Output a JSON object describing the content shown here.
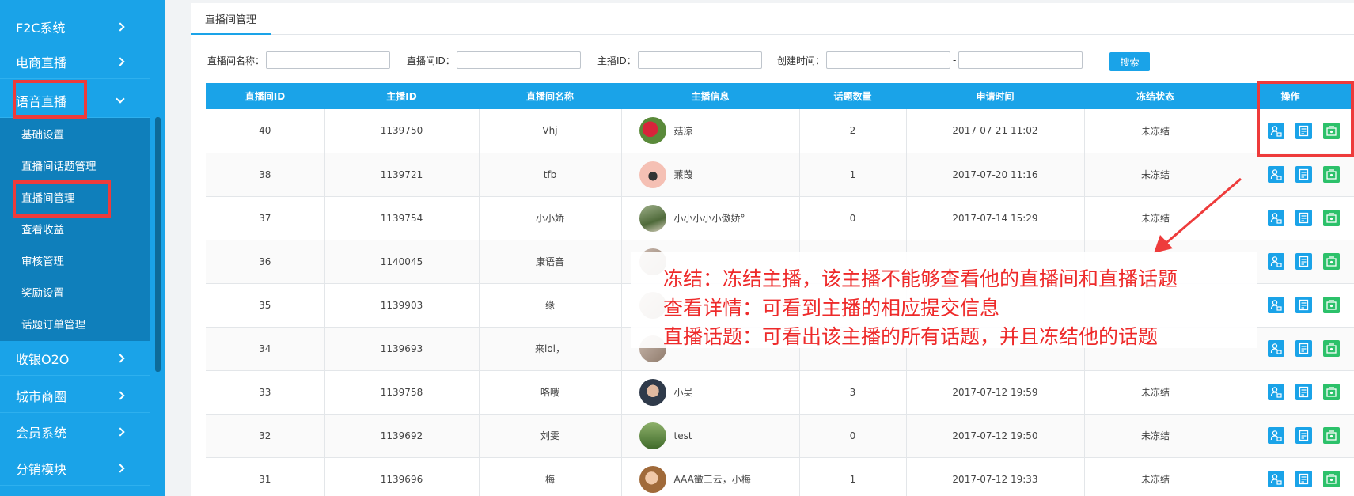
{
  "sidebar": {
    "items": [
      {
        "label": "F2C系统"
      },
      {
        "label": "电商直播"
      },
      {
        "label": "语音直播"
      },
      {
        "label": "收银O2O"
      },
      {
        "label": "城市商圈"
      },
      {
        "label": "会员系统"
      },
      {
        "label": "分销模块"
      }
    ],
    "subitems": [
      {
        "label": "基础设置"
      },
      {
        "label": "直播间话题管理"
      },
      {
        "label": "直播间管理"
      },
      {
        "label": "查看收益"
      },
      {
        "label": "审核管理"
      },
      {
        "label": "奖励设置"
      },
      {
        "label": "话题订单管理"
      }
    ]
  },
  "tab": {
    "label": "直播间管理"
  },
  "filters": {
    "room_name_label": "直播间名称：",
    "room_id_label": "直播间ID：",
    "host_id_label": "主播ID：",
    "created_time_label": "创建时间：",
    "date_separator": "-",
    "search_label": "搜索"
  },
  "table": {
    "headers": [
      "直播间ID",
      "主播ID",
      "直播间名称",
      "主播信息",
      "话题数量",
      "申请时间",
      "冻结状态",
      "操作"
    ],
    "rows": [
      {
        "room_id": "40",
        "host_id": "1139750",
        "room_name": "Vhj",
        "host_name": "菇凉",
        "topics": "2",
        "apply_time": "2017-07-21 11:02",
        "status": "未冻结",
        "avatar": "rose-avatar"
      },
      {
        "room_id": "38",
        "host_id": "1139721",
        "room_name": "tfb",
        "host_name": "蒹葭",
        "topics": "1",
        "apply_time": "2017-07-20 11:16",
        "status": "未冻结",
        "avatar": "cartoon-avatar"
      },
      {
        "room_id": "37",
        "host_id": "1139754",
        "room_name": "小小娇",
        "host_name": "小小小小小傲娇°",
        "topics": "0",
        "apply_time": "2017-07-14 15:29",
        "status": "未冻结",
        "avatar": "outdoor-avatar"
      },
      {
        "room_id": "36",
        "host_id": "1140045",
        "room_name": "康语音",
        "host_name": "",
        "topics": "",
        "apply_time": "",
        "status": "",
        "avatar": "blurred-avatar"
      },
      {
        "room_id": "35",
        "host_id": "1139903",
        "room_name": "缘",
        "host_name": "",
        "topics": "",
        "apply_time": "",
        "status": "",
        "avatar": "blurred-avatar"
      },
      {
        "room_id": "34",
        "host_id": "1139693",
        "room_name": "来lol，",
        "host_name": "",
        "topics": "",
        "apply_time": "",
        "status": "",
        "avatar": "blurred-avatar"
      },
      {
        "room_id": "33",
        "host_id": "1139758",
        "room_name": "咯哦",
        "host_name": "小吴",
        "topics": "3",
        "apply_time": "2017-07-12 19:59",
        "status": "未冻结",
        "avatar": "man-avatar"
      },
      {
        "room_id": "32",
        "host_id": "1139692",
        "room_name": "刘雯",
        "host_name": "test",
        "topics": "0",
        "apply_time": "2017-07-12 19:50",
        "status": "未冻结",
        "avatar": "grass-avatar"
      },
      {
        "room_id": "31",
        "host_id": "1139696",
        "room_name": "梅",
        "host_name": "AAA徵三云，小梅",
        "topics": "1",
        "apply_time": "2017-07-12 19:33",
        "status": "未冻结",
        "avatar": "girl-avatar"
      }
    ]
  },
  "annotation": {
    "lines": [
      "冻结：冻结主播，该主播不能够查看他的直播间和直播话题",
      "查看详情：可看到主播的相应提交信息",
      "直播话题：可看出该主播的所有话题，并且冻结他的话题"
    ],
    "color": "#ee2a2a"
  },
  "colors": {
    "primary": "#1aa3e8",
    "sidebar_sub": "#0f7fbb",
    "green": "#2cc16a",
    "annotation_red": "#ee3b3b"
  }
}
